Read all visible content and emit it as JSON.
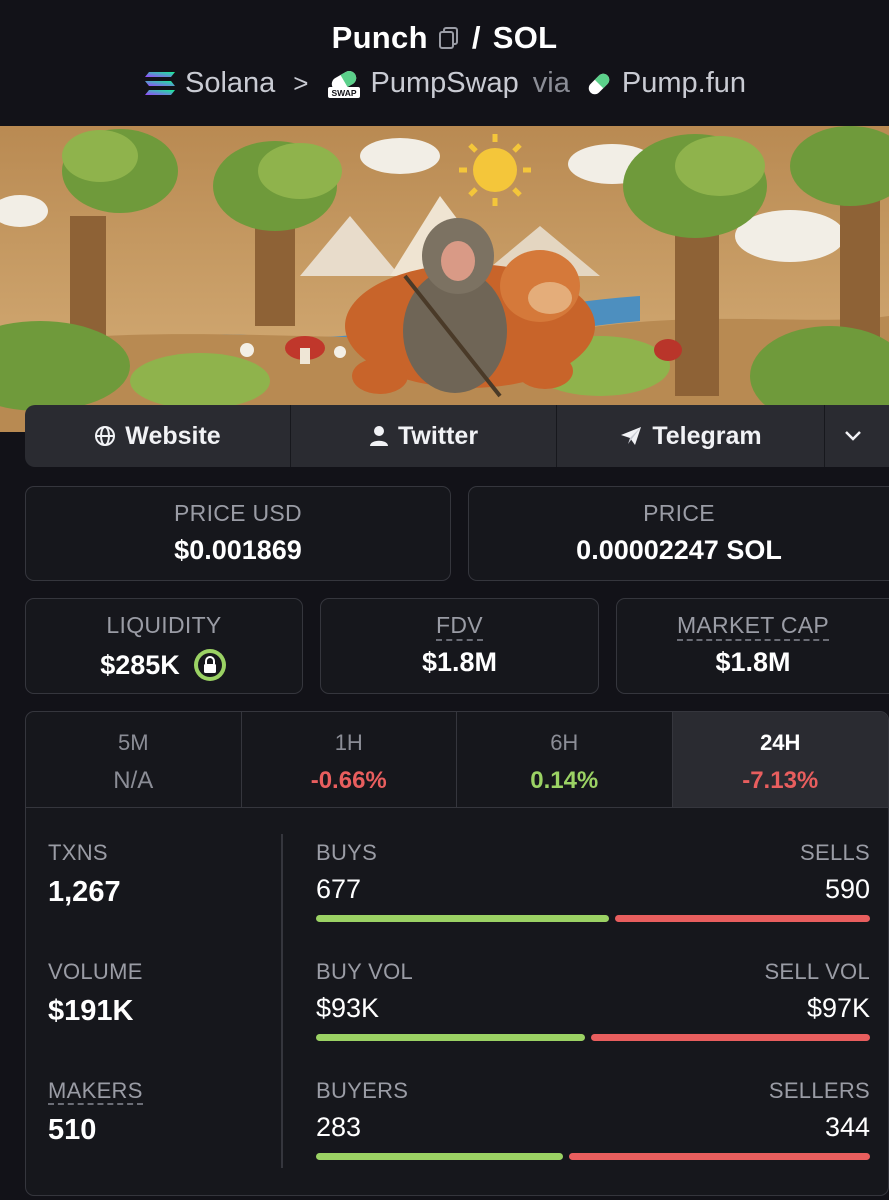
{
  "header": {
    "token": "Punch",
    "pair_sep": "/",
    "quote": "SOL",
    "chain": "Solana",
    "dex": "PumpSwap",
    "via": "via",
    "launchpad": "Pump.fun",
    "swap_badge": "SWAP"
  },
  "links": {
    "website": "Website",
    "twitter": "Twitter",
    "telegram": "Telegram"
  },
  "prices": {
    "price_usd_label": "PRICE USD",
    "price_usd": "$0.001869",
    "price_label": "PRICE",
    "price": "0.00002247 SOL"
  },
  "metrics": {
    "liquidity_label": "LIQUIDITY",
    "liquidity": "$285K",
    "fdv_label": "FDV",
    "fdv": "$1.8M",
    "mcap_label": "MARKET CAP",
    "mcap": "$1.8M"
  },
  "tabs": [
    {
      "label": "5M",
      "value": "N/A"
    },
    {
      "label": "1H",
      "value": "-0.66%"
    },
    {
      "label": "6H",
      "value": "0.14%"
    },
    {
      "label": "24H",
      "value": "-7.13%"
    }
  ],
  "stats": {
    "txns_label": "TXNS",
    "txns": "1,267",
    "volume_label": "VOLUME",
    "volume": "$191K",
    "makers_label": "MAKERS",
    "makers": "510",
    "buys_label": "BUYS",
    "buys": "677",
    "sells_label": "SELLS",
    "sells": "590",
    "buy_vol_label": "BUY VOL",
    "buy_vol": "$93K",
    "sell_vol_label": "SELL VOL",
    "sell_vol": "$97K",
    "buyers_label": "BUYERS",
    "buyers": "283",
    "sellers_label": "SELLERS",
    "sellers": "344"
  },
  "ratios": {
    "buys_share": 0.534,
    "buy_vol_share": 0.49,
    "buyers_share": 0.451
  },
  "colors": {
    "green": "#9bd264",
    "red": "#e85e5e",
    "background": "#121218"
  }
}
